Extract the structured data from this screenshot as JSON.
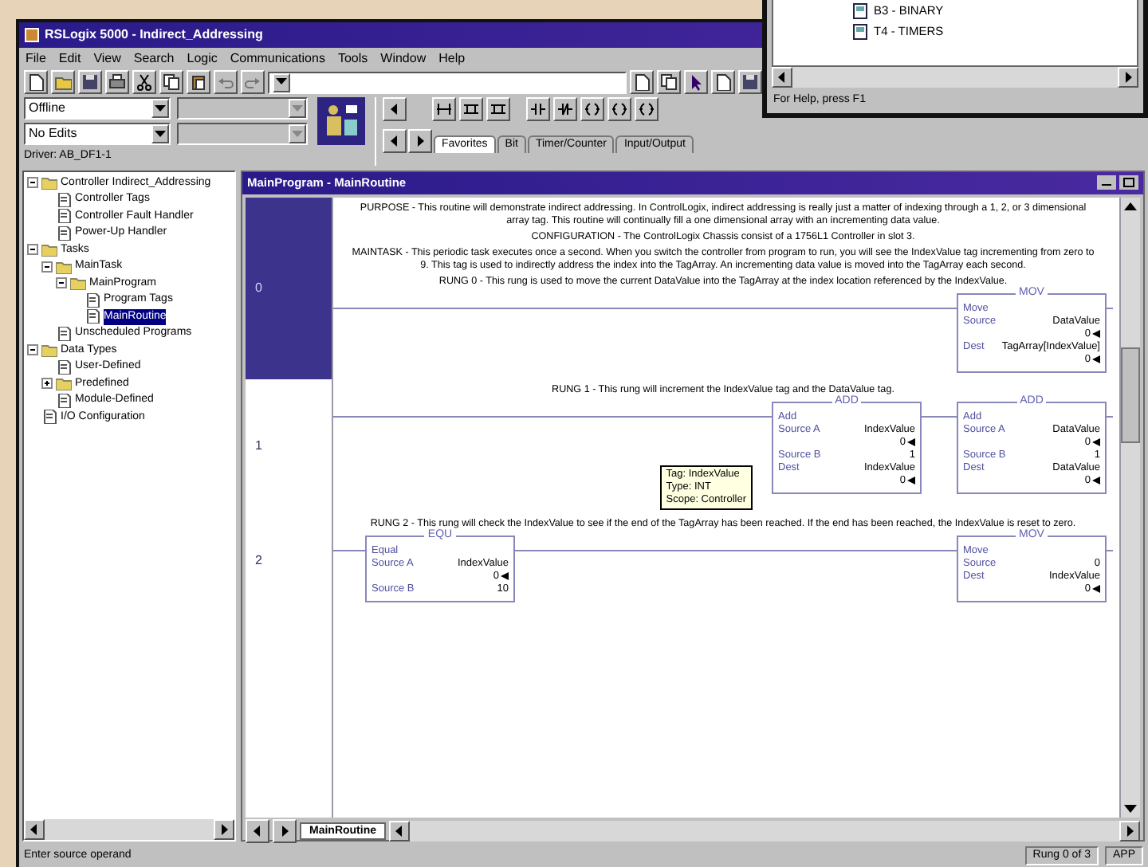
{
  "window": {
    "title": "RSLogix 5000 - Indirect_Addressing"
  },
  "menu": [
    "File",
    "Edit",
    "View",
    "Search",
    "Logic",
    "Communications",
    "Tools",
    "Window",
    "Help"
  ],
  "controller_status": {
    "mode": "Offline",
    "edits": "No Edits",
    "driver": "Driver: AB_DF1-1"
  },
  "instruction_tabs": [
    {
      "label": "Favorites",
      "selected": true
    },
    {
      "label": "Bit",
      "selected": false
    },
    {
      "label": "Timer/Counter",
      "selected": false
    },
    {
      "label": "Input/Output",
      "selected": false
    }
  ],
  "tree": [
    {
      "label": "Controller Indirect_Addressing",
      "selected": false,
      "expanded": true,
      "children": [
        {
          "label": "Controller Tags",
          "selected": false
        },
        {
          "label": "Controller Fault Handler",
          "selected": false
        },
        {
          "label": "Power-Up Handler",
          "selected": false
        }
      ]
    },
    {
      "label": "Tasks",
      "selected": false,
      "expanded": true,
      "children": [
        {
          "label": "MainTask",
          "selected": false,
          "expanded": true,
          "children": [
            {
              "label": "MainProgram",
              "selected": false,
              "expanded": true,
              "children": [
                {
                  "label": "Program Tags",
                  "selected": false
                },
                {
                  "label": "MainRoutine",
                  "selected": true
                }
              ]
            }
          ]
        },
        {
          "label": "Unscheduled Programs",
          "selected": false
        }
      ]
    },
    {
      "label": "Data Types",
      "selected": false,
      "expanded": true,
      "children": [
        {
          "label": "User-Defined",
          "selected": false
        },
        {
          "label": "Predefined",
          "selected": false,
          "expanded": false
        },
        {
          "label": "Module-Defined",
          "selected": false
        }
      ]
    },
    {
      "label": "I/O Configuration",
      "selected": false
    }
  ],
  "routine_window": {
    "title": "MainProgram - MainRoutine",
    "sheet_tab": "MainRoutine",
    "rungs": [
      {
        "number": "0",
        "selected": true,
        "comments": [
          "PURPOSE - This routine will demonstrate indirect addressing. In ControlLogix, indirect addressing is really just a matter of indexing through a 1, 2, or 3 dimensional array tag. This routine will continually fill a one dimensional array with an incrementing data value.",
          "CONFIGURATION - The ControlLogix Chassis consist of a 1756L1 Controller in slot 3.",
          "MAINTASK - This periodic task executes once a second. When you switch the controller from program to run, you will see the IndexValue tag incrementing from zero to 9. This tag is used to indirectly address the index into the TagArray. An incrementing data value is moved into the TagArray each second.",
          "RUNG 0 - This rung is used to move the current DataValue into the TagArray at the index location referenced by the IndexValue."
        ],
        "outputs": [
          {
            "mnemonic": "MOV",
            "name": "Move",
            "operands": [
              {
                "label": "Source",
                "value": "DataValue",
                "live": "0"
              },
              {
                "label": "Dest",
                "value": "TagArray[IndexValue]",
                "live": "0"
              }
            ]
          }
        ]
      },
      {
        "number": "1",
        "selected": false,
        "comments": [
          "RUNG 1 - This rung will increment the IndexValue tag and the DataValue tag."
        ],
        "outputs": [
          {
            "mnemonic": "ADD",
            "name": "Add",
            "operands": [
              {
                "label": "Source A",
                "value": "IndexValue",
                "live": "0"
              },
              {
                "label": "Source B",
                "value": "1"
              },
              {
                "label": "Dest",
                "value": "IndexValue",
                "live": "0"
              }
            ]
          },
          {
            "mnemonic": "ADD",
            "name": "Add",
            "operands": [
              {
                "label": "Source A",
                "value": "DataValue",
                "live": "0"
              },
              {
                "label": "Source B",
                "value": "1"
              },
              {
                "label": "Dest",
                "value": "DataValue",
                "live": "0"
              }
            ]
          }
        ]
      },
      {
        "number": "2",
        "selected": false,
        "comments": [
          "RUNG 2 - This rung will check the IndexValue to see if the end of the TagArray has been reached. If the end has been reached, the IndexValue is reset to zero."
        ],
        "conditions": [
          {
            "mnemonic": "EQU",
            "name": "Equal",
            "operands": [
              {
                "label": "Source A",
                "value": "IndexValue",
                "live": "0"
              },
              {
                "label": "Source B",
                "value": "10"
              }
            ]
          }
        ],
        "outputs": [
          {
            "mnemonic": "MOV",
            "name": "Move",
            "operands": [
              {
                "label": "Source",
                "value": "0"
              },
              {
                "label": "Dest",
                "value": "IndexValue",
                "live": "0"
              }
            ]
          }
        ]
      }
    ]
  },
  "tooltip": [
    "Tag: IndexValue",
    "Type: INT",
    "Scope: Controller"
  ],
  "status_bar": {
    "message": "Enter source operand",
    "rung": "Rung 0 of 3",
    "mode": "APP"
  },
  "help_window": {
    "items": [
      "B3 - BINARY",
      "T4 - TIMERS"
    ],
    "status": "For Help, press F1"
  }
}
